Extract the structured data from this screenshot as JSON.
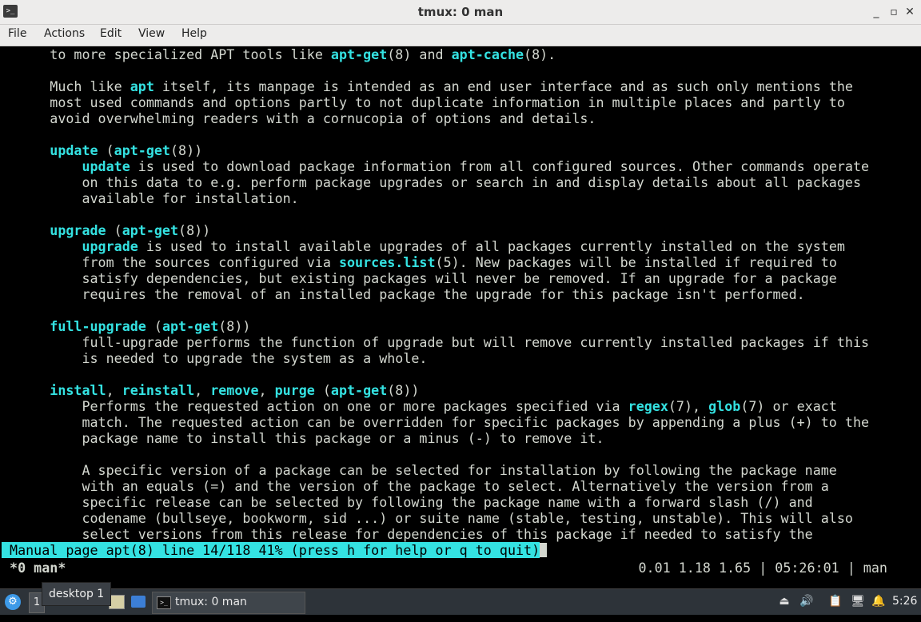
{
  "window": {
    "title": "tmux: 0 man",
    "icon": "terminal-icon",
    "controls": [
      "minimize-icon",
      "maximize-icon",
      "close-icon"
    ]
  },
  "menu": [
    "File",
    "Actions",
    "Edit",
    "View",
    "Help"
  ],
  "manpage": {
    "lines": [
      [
        [
          "      to more specialized APT tools like ",
          0
        ],
        [
          "apt-get",
          1
        ],
        [
          "(8) and ",
          0
        ],
        [
          "apt-cache",
          1
        ],
        [
          "(8).",
          0
        ]
      ],
      [],
      [
        [
          "      Much like ",
          0
        ],
        [
          "apt",
          1
        ],
        [
          " itself, its manpage is intended as an end user interface and as such only mentions the",
          0
        ]
      ],
      [
        [
          "      most used commands and options partly to not duplicate information in multiple places and partly to",
          0
        ]
      ],
      [
        [
          "      avoid overwhelming readers with a cornucopia of options and details.",
          0
        ]
      ],
      [],
      [
        [
          "      ",
          0
        ],
        [
          "update",
          1
        ],
        [
          " (",
          0
        ],
        [
          "apt-get",
          1
        ],
        [
          "(8))",
          0
        ]
      ],
      [
        [
          "          ",
          0
        ],
        [
          "update",
          1
        ],
        [
          " is used to download package information from all configured sources. Other commands operate",
          0
        ]
      ],
      [
        [
          "          on this data to e.g. perform package upgrades or search in and display details about all packages",
          0
        ]
      ],
      [
        [
          "          available for installation.",
          0
        ]
      ],
      [],
      [
        [
          "      ",
          0
        ],
        [
          "upgrade",
          1
        ],
        [
          " (",
          0
        ],
        [
          "apt-get",
          1
        ],
        [
          "(8))",
          0
        ]
      ],
      [
        [
          "          ",
          0
        ],
        [
          "upgrade",
          1
        ],
        [
          " is used to install available upgrades of all packages currently installed on the system",
          0
        ]
      ],
      [
        [
          "          from the sources configured via ",
          0
        ],
        [
          "sources.list",
          1
        ],
        [
          "(5). New packages will be installed if required to",
          0
        ]
      ],
      [
        [
          "          satisfy dependencies, but existing packages will never be removed. If an upgrade for a package",
          0
        ]
      ],
      [
        [
          "          requires the removal of an installed package the upgrade for this package isn't performed.",
          0
        ]
      ],
      [],
      [
        [
          "      ",
          0
        ],
        [
          "full-upgrade",
          1
        ],
        [
          " (",
          0
        ],
        [
          "apt-get",
          1
        ],
        [
          "(8))",
          0
        ]
      ],
      [
        [
          "          full-upgrade performs the function of upgrade but will remove currently installed packages if this",
          0
        ]
      ],
      [
        [
          "          is needed to upgrade the system as a whole.",
          0
        ]
      ],
      [],
      [
        [
          "      ",
          0
        ],
        [
          "install",
          1
        ],
        [
          ", ",
          0
        ],
        [
          "reinstall",
          1
        ],
        [
          ", ",
          0
        ],
        [
          "remove",
          1
        ],
        [
          ", ",
          0
        ],
        [
          "purge",
          1
        ],
        [
          " (",
          0
        ],
        [
          "apt-get",
          1
        ],
        [
          "(8))",
          0
        ]
      ],
      [
        [
          "          Performs the requested action on one or more packages specified via ",
          0
        ],
        [
          "regex",
          1
        ],
        [
          "(7), ",
          0
        ],
        [
          "glob",
          1
        ],
        [
          "(7) or exact",
          0
        ]
      ],
      [
        [
          "          match. The requested action can be overridden for specific packages by appending a plus (+) to the",
          0
        ]
      ],
      [
        [
          "          package name to install this package or a minus (-) to remove it.",
          0
        ]
      ],
      [],
      [
        [
          "          A specific version of a package can be selected for installation by following the package name",
          0
        ]
      ],
      [
        [
          "          with an equals (=) and the version of the package to select. Alternatively the version from a",
          0
        ]
      ],
      [
        [
          "          specific release can be selected by following the package name with a forward slash (/) and",
          0
        ]
      ],
      [
        [
          "          codename (bullseye, bookworm, sid ...) or suite name (stable, testing, unstable). This will also",
          0
        ]
      ],
      [
        [
          "          select versions from this release for dependencies of this package if needed to satisfy the",
          0
        ]
      ]
    ],
    "status": " Manual page apt(8) line 14/118 41% (press h for help or q to quit)"
  },
  "tmux": {
    "left": " *0 man*",
    "right": "0.01 1.18 1.65 | 05:26:01 | man "
  },
  "taskbar": {
    "start_icon": "lxqt-start-icon",
    "desktop_number": "1",
    "desktop_tooltip": "desktop 1",
    "file_manager_icon": "file-manager-icon",
    "window_label": "tmux: 0 man",
    "tray_icons": [
      "removable-media-icon",
      "volume-icon",
      "clipboard-icon",
      "network-icon",
      "notification-icon"
    ],
    "clock": "5:26"
  },
  "colors": {
    "terminal_bg": "#000000",
    "terminal_fg": "#d3d7cf",
    "bold_fg": "#34e2e2",
    "status_bg": "#34e2e2"
  }
}
